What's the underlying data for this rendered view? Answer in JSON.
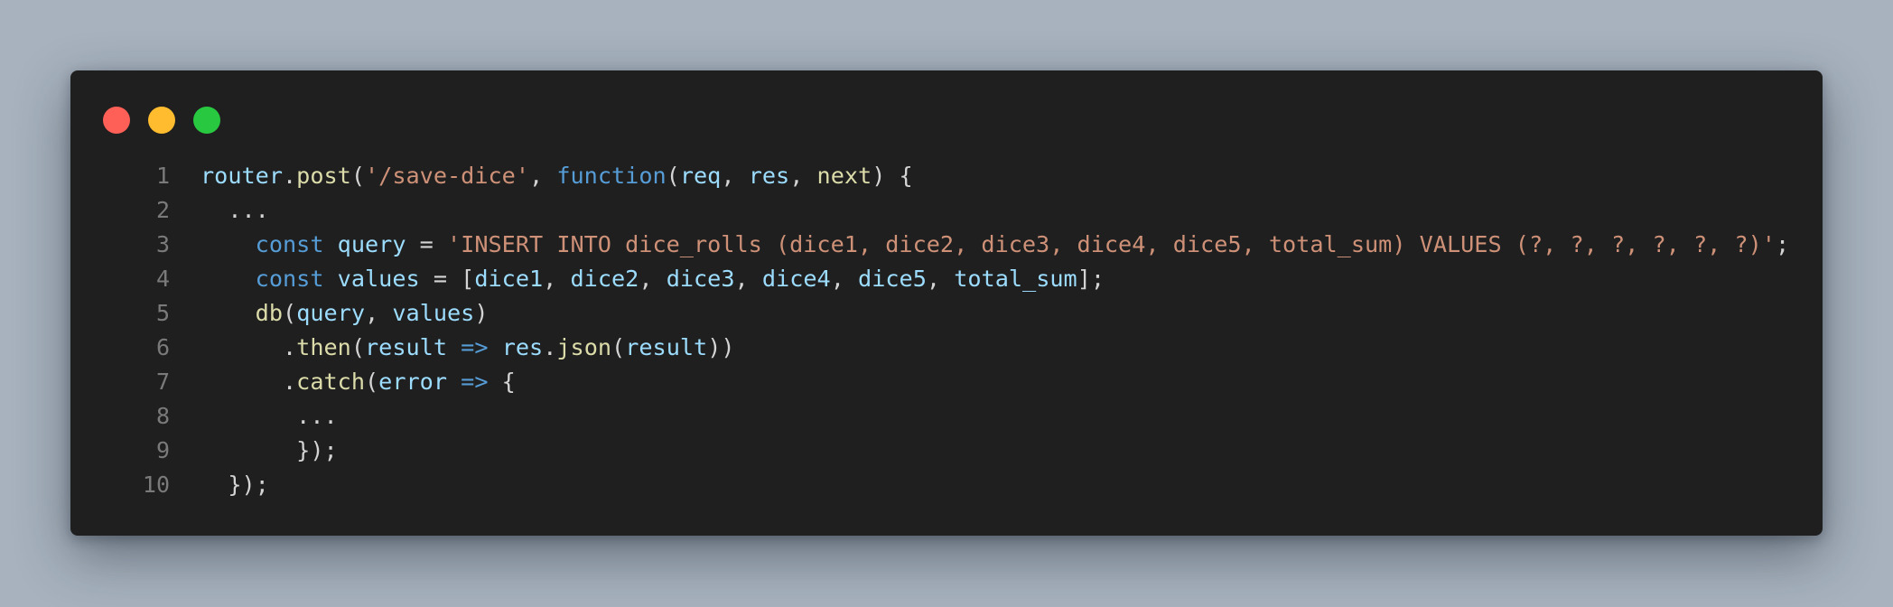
{
  "window": {
    "controls": [
      "close",
      "minimize",
      "zoom"
    ]
  },
  "code": {
    "lines": [
      {
        "number": "1",
        "tokens": [
          {
            "t": "router",
            "c": "var"
          },
          {
            "t": ".",
            "c": "pl"
          },
          {
            "t": "post",
            "c": "fn"
          },
          {
            "t": "(",
            "c": "pl"
          },
          {
            "t": "'/save-dice'",
            "c": "str"
          },
          {
            "t": ", ",
            "c": "pl"
          },
          {
            "t": "function",
            "c": "kw"
          },
          {
            "t": "(",
            "c": "pl"
          },
          {
            "t": "req",
            "c": "var"
          },
          {
            "t": ", ",
            "c": "pl"
          },
          {
            "t": "res",
            "c": "var"
          },
          {
            "t": ", ",
            "c": "pl"
          },
          {
            "t": "next",
            "c": "fn"
          },
          {
            "t": ") {",
            "c": "pl"
          }
        ]
      },
      {
        "number": "2",
        "tokens": [
          {
            "t": "  ...",
            "c": "pl"
          }
        ]
      },
      {
        "number": "3",
        "tokens": [
          {
            "t": "    ",
            "c": "pl"
          },
          {
            "t": "const",
            "c": "kw"
          },
          {
            "t": " ",
            "c": "pl"
          },
          {
            "t": "query",
            "c": "var"
          },
          {
            "t": " = ",
            "c": "pl"
          },
          {
            "t": "'INSERT INTO dice_rolls (dice1, dice2, dice3, dice4, dice5, total_sum) VALUES (?, ?, ?, ?, ?, ?)'",
            "c": "str"
          },
          {
            "t": ";",
            "c": "pl"
          }
        ]
      },
      {
        "number": "4",
        "tokens": [
          {
            "t": "    ",
            "c": "pl"
          },
          {
            "t": "const",
            "c": "kw"
          },
          {
            "t": " ",
            "c": "pl"
          },
          {
            "t": "values",
            "c": "var"
          },
          {
            "t": " = [",
            "c": "pl"
          },
          {
            "t": "dice1",
            "c": "var"
          },
          {
            "t": ", ",
            "c": "pl"
          },
          {
            "t": "dice2",
            "c": "var"
          },
          {
            "t": ", ",
            "c": "pl"
          },
          {
            "t": "dice3",
            "c": "var"
          },
          {
            "t": ", ",
            "c": "pl"
          },
          {
            "t": "dice4",
            "c": "var"
          },
          {
            "t": ", ",
            "c": "pl"
          },
          {
            "t": "dice5",
            "c": "var"
          },
          {
            "t": ", ",
            "c": "pl"
          },
          {
            "t": "total_sum",
            "c": "var"
          },
          {
            "t": "];",
            "c": "pl"
          }
        ]
      },
      {
        "number": "5",
        "tokens": [
          {
            "t": "    ",
            "c": "pl"
          },
          {
            "t": "db",
            "c": "fn"
          },
          {
            "t": "(",
            "c": "pl"
          },
          {
            "t": "query",
            "c": "var"
          },
          {
            "t": ", ",
            "c": "pl"
          },
          {
            "t": "values",
            "c": "var"
          },
          {
            "t": ")",
            "c": "pl"
          }
        ]
      },
      {
        "number": "6",
        "tokens": [
          {
            "t": "      .",
            "c": "pl"
          },
          {
            "t": "then",
            "c": "fn"
          },
          {
            "t": "(",
            "c": "pl"
          },
          {
            "t": "result",
            "c": "var"
          },
          {
            "t": " ",
            "c": "pl"
          },
          {
            "t": "=>",
            "c": "kw"
          },
          {
            "t": " ",
            "c": "pl"
          },
          {
            "t": "res",
            "c": "var"
          },
          {
            "t": ".",
            "c": "pl"
          },
          {
            "t": "json",
            "c": "fn"
          },
          {
            "t": "(",
            "c": "pl"
          },
          {
            "t": "result",
            "c": "var"
          },
          {
            "t": "))",
            "c": "pl"
          }
        ]
      },
      {
        "number": "7",
        "tokens": [
          {
            "t": "      .",
            "c": "pl"
          },
          {
            "t": "catch",
            "c": "fn"
          },
          {
            "t": "(",
            "c": "pl"
          },
          {
            "t": "error",
            "c": "var"
          },
          {
            "t": " ",
            "c": "pl"
          },
          {
            "t": "=>",
            "c": "kw"
          },
          {
            "t": " {",
            "c": "pl"
          }
        ]
      },
      {
        "number": "8",
        "tokens": [
          {
            "t": "       ...",
            "c": "pl"
          }
        ]
      },
      {
        "number": "9",
        "tokens": [
          {
            "t": "       });",
            "c": "pl"
          }
        ]
      },
      {
        "number": "10",
        "tokens": [
          {
            "t": "  });",
            "c": "pl"
          }
        ]
      }
    ]
  }
}
